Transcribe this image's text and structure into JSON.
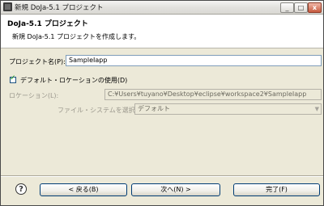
{
  "window": {
    "title": "新規 DoJa-5.1 プロジェクト",
    "minimize": "_",
    "maximize": "□",
    "close": "x"
  },
  "header": {
    "title": "DoJa-5.1 プロジェクト",
    "description": "新規 DoJa-5.1 プロジェクトを作成します。"
  },
  "form": {
    "project_name_label": "プロジェクト名(P):",
    "project_name_value": "SampleIapp",
    "default_location_label": "デフォルト・ロケーションの使用(D)",
    "default_location_checked": true,
    "location_label": "ロケーション(L):",
    "location_value": "C:¥Users¥tuyano¥Desktop¥eclipse¥workspace2¥SampleIapp",
    "filesystem_label": "ファイル・システムを選択:",
    "filesystem_value": "デフォルト"
  },
  "buttons": {
    "help": "?",
    "back": "< 戻る(B)",
    "next": "次へ(N) >",
    "finish": "完了(F)"
  }
}
